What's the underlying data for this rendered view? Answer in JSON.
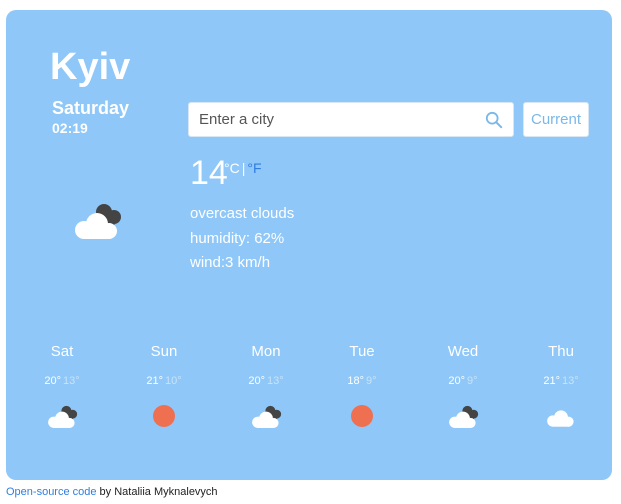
{
  "weather": {
    "city": "Kyiv",
    "day": "Saturday",
    "time": "02:19",
    "temperature": "14",
    "unit_celsius": "°C",
    "unit_separator": "|",
    "unit_fahrenheit": "°F",
    "description": "overcast clouds",
    "humidity": "humidity: 62%",
    "wind": "wind:3 km/h",
    "icon": "overcast-clouds-icon"
  },
  "search": {
    "placeholder": "Enter a city",
    "current_label": "Current"
  },
  "forecast": [
    {
      "day": "Sat",
      "max": "20°",
      "min": "13°",
      "icon": "overcast-clouds-icon"
    },
    {
      "day": "Sun",
      "max": "21°",
      "min": "10°",
      "icon": "clear-sun-icon"
    },
    {
      "day": "Mon",
      "max": "20°",
      "min": "13°",
      "icon": "overcast-clouds-icon"
    },
    {
      "day": "Tue",
      "max": "18°",
      "min": "9°",
      "icon": "clear-sun-icon"
    },
    {
      "day": "Wed",
      "max": "20°",
      "min": "9°",
      "icon": "overcast-clouds-icon"
    },
    {
      "day": "Thu",
      "max": "21°",
      "min": "13°",
      "icon": "cloud-icon"
    }
  ],
  "footer": {
    "link_text": "Open-source code",
    "author_text": " by Nataliia Myknalevych"
  },
  "colors": {
    "card_background": "#8ec7f8",
    "sun": "#ef6f51",
    "link": "#2f7ee0",
    "cloud_dark": "#444444",
    "cloud_light": "#ffffff"
  }
}
